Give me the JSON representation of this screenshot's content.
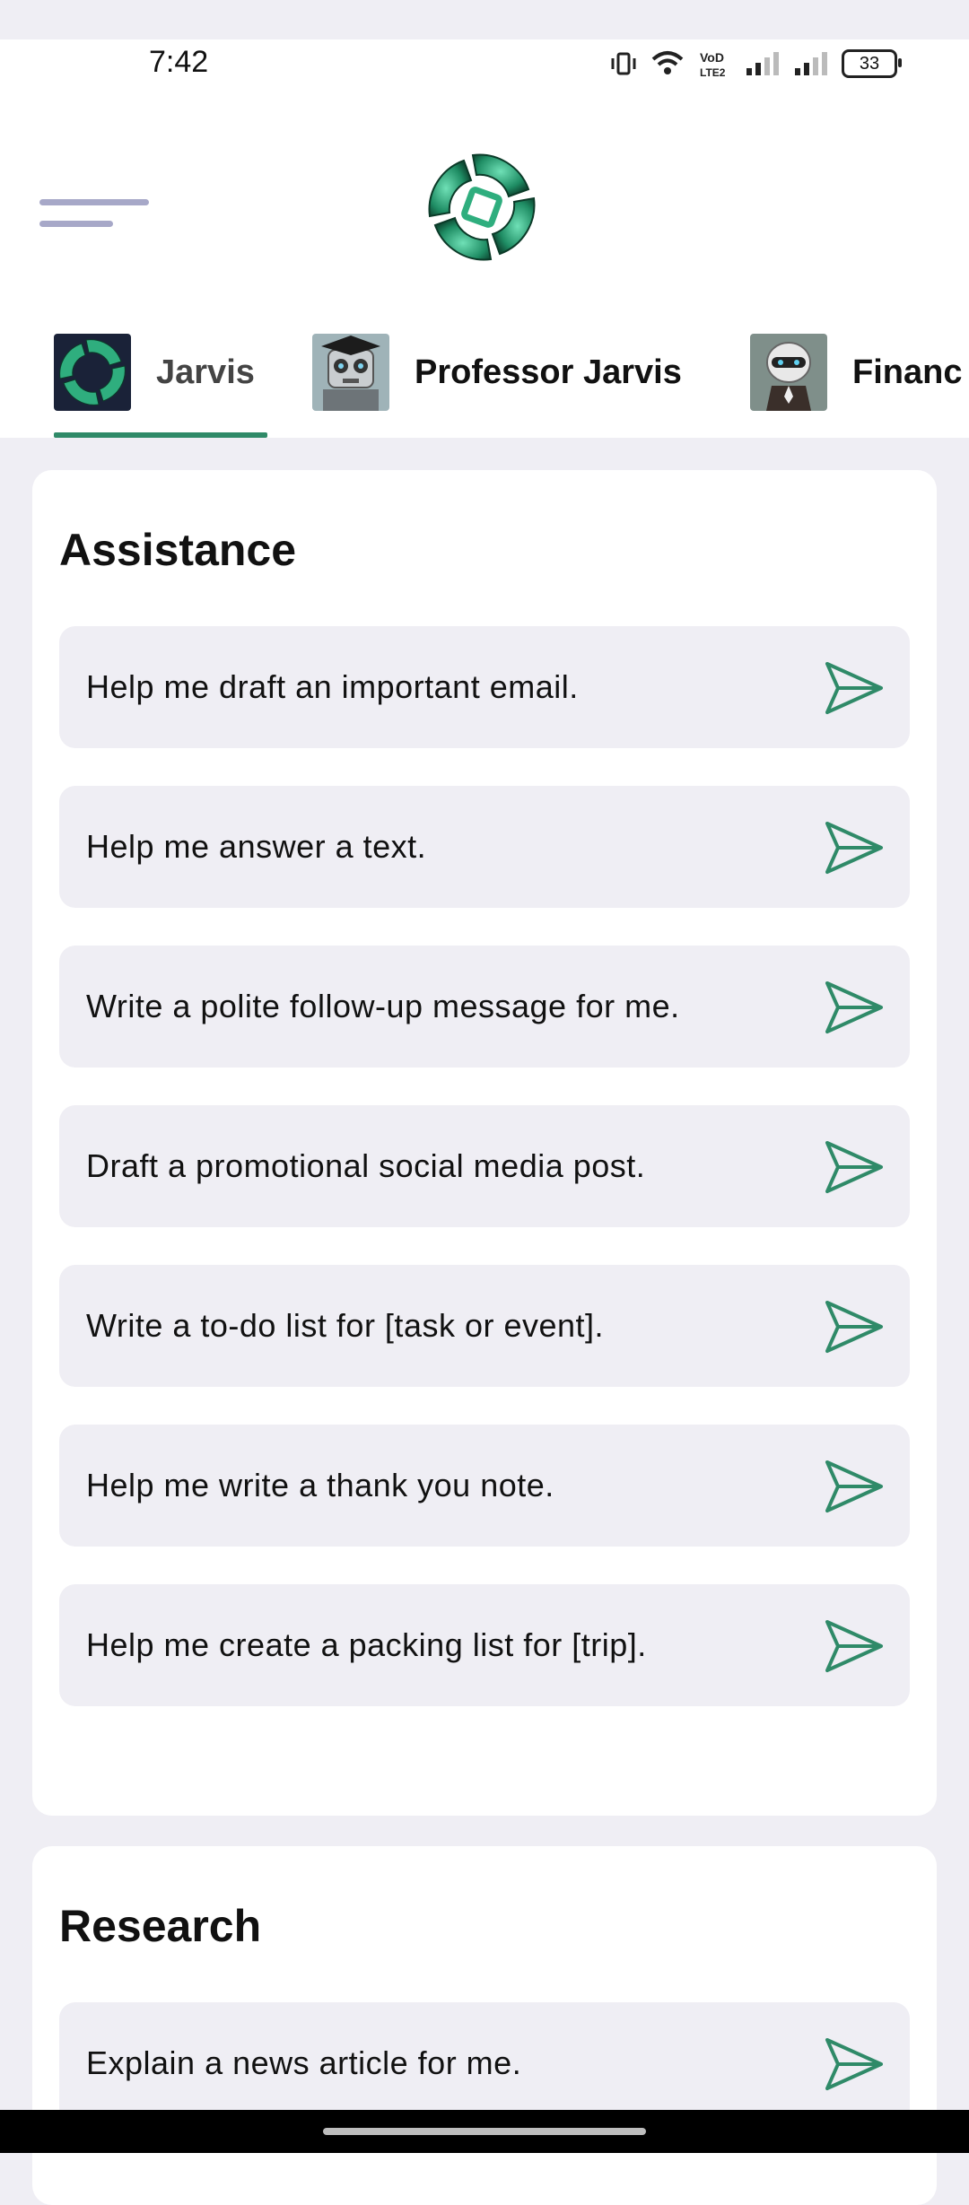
{
  "status_bar": {
    "time": "7:42",
    "battery_level": "33",
    "network_label": "VoLTE2",
    "icons": [
      "vibrate-icon",
      "wifi-icon",
      "volte-icon",
      "signal-icon",
      "signal-icon",
      "battery-icon"
    ]
  },
  "header": {
    "menu_icon": "hamburger-menu-icon",
    "logo_icon": "app-logo-icon"
  },
  "tabs": [
    {
      "label": "Jarvis",
      "active": true
    },
    {
      "label": "Professor Jarvis",
      "active": false
    },
    {
      "label": "Financ",
      "active": false
    }
  ],
  "sections": [
    {
      "title": "Assistance",
      "prompts": [
        "Help me draft an important email.",
        "Help me answer a text.",
        "Write a polite follow-up message for me.",
        "Draft a promotional social media post.",
        "Write a to-do list for [task or event].",
        "Help me write a thank you note.",
        "Help me create a packing list for [trip]."
      ]
    },
    {
      "title": "Research",
      "prompts": [
        "Explain a news article for me."
      ]
    }
  ],
  "colors": {
    "accent": "#2f8a68",
    "background": "#efeef4",
    "card": "#ffffff",
    "menu_lines": "#a7a8c8"
  }
}
